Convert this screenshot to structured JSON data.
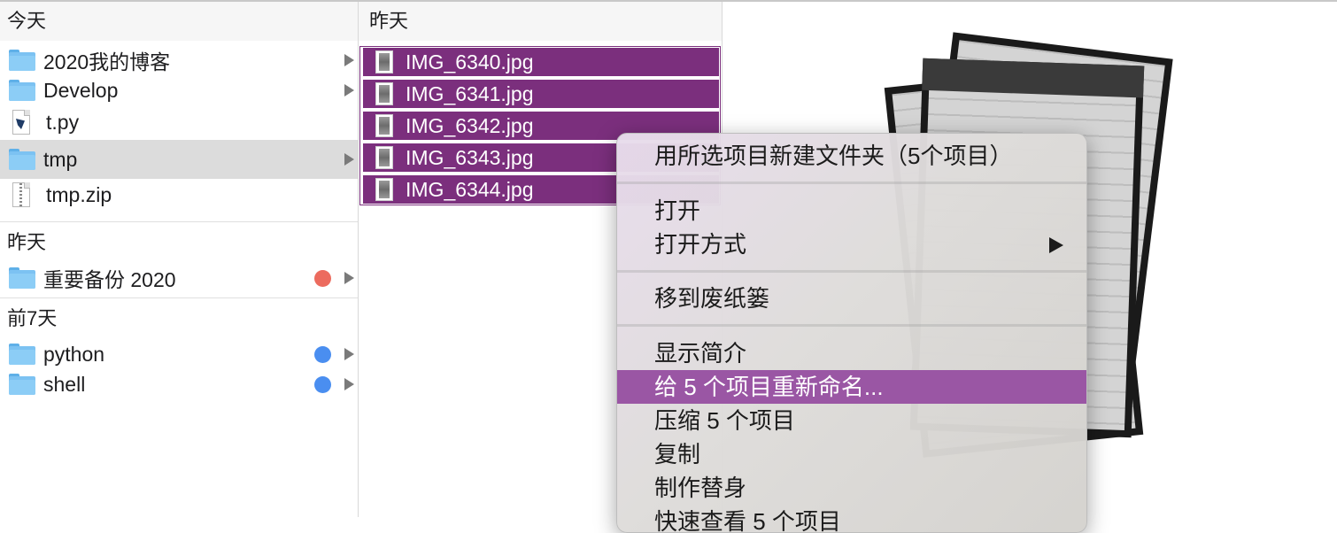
{
  "column1": {
    "sections": [
      {
        "title": "今天",
        "items": [
          {
            "name": "2020我的博客",
            "type": "folder",
            "arrow": true
          },
          {
            "name": "Develop",
            "type": "folder",
            "arrow": true
          },
          {
            "name": "t.py",
            "type": "python-file",
            "arrow": false
          },
          {
            "name": "tmp",
            "type": "folder",
            "arrow": true,
            "selected": true
          },
          {
            "name": "tmp.zip",
            "type": "zip-file",
            "arrow": false
          }
        ]
      },
      {
        "title": "昨天",
        "items": [
          {
            "name": "重要备份 2020",
            "type": "folder",
            "arrow": true,
            "tag_color": "#ec6b5e"
          }
        ]
      },
      {
        "title": "前7天",
        "items": [
          {
            "name": "python",
            "type": "folder",
            "arrow": true,
            "tag_color": "#4a8ef0"
          },
          {
            "name": "shell",
            "type": "folder",
            "arrow": true,
            "tag_color": "#4a8ef0"
          }
        ]
      }
    ]
  },
  "column2": {
    "title": "昨天",
    "selected_color": "#7b2f7d",
    "files": [
      "IMG_6340.jpg",
      "IMG_6341.jpg",
      "IMG_6342.jpg",
      "IMG_6343.jpg",
      "IMG_6344.jpg"
    ]
  },
  "context_menu": {
    "highlight_color": "#9a56a4",
    "items": [
      {
        "label": "用所选项目新建文件夹（5个项目）"
      },
      {
        "separator": true
      },
      {
        "label": "打开"
      },
      {
        "label": "打开方式",
        "submenu": true
      },
      {
        "separator": true
      },
      {
        "label": "移到废纸篓"
      },
      {
        "separator": true
      },
      {
        "label": "显示简介"
      },
      {
        "label": "给 5 个项目重新命名...",
        "highlighted": true
      },
      {
        "label": "压缩 5 个项目"
      },
      {
        "label": "复制"
      },
      {
        "label": "制作替身"
      },
      {
        "label": "快速查看 5 个项目"
      }
    ]
  }
}
